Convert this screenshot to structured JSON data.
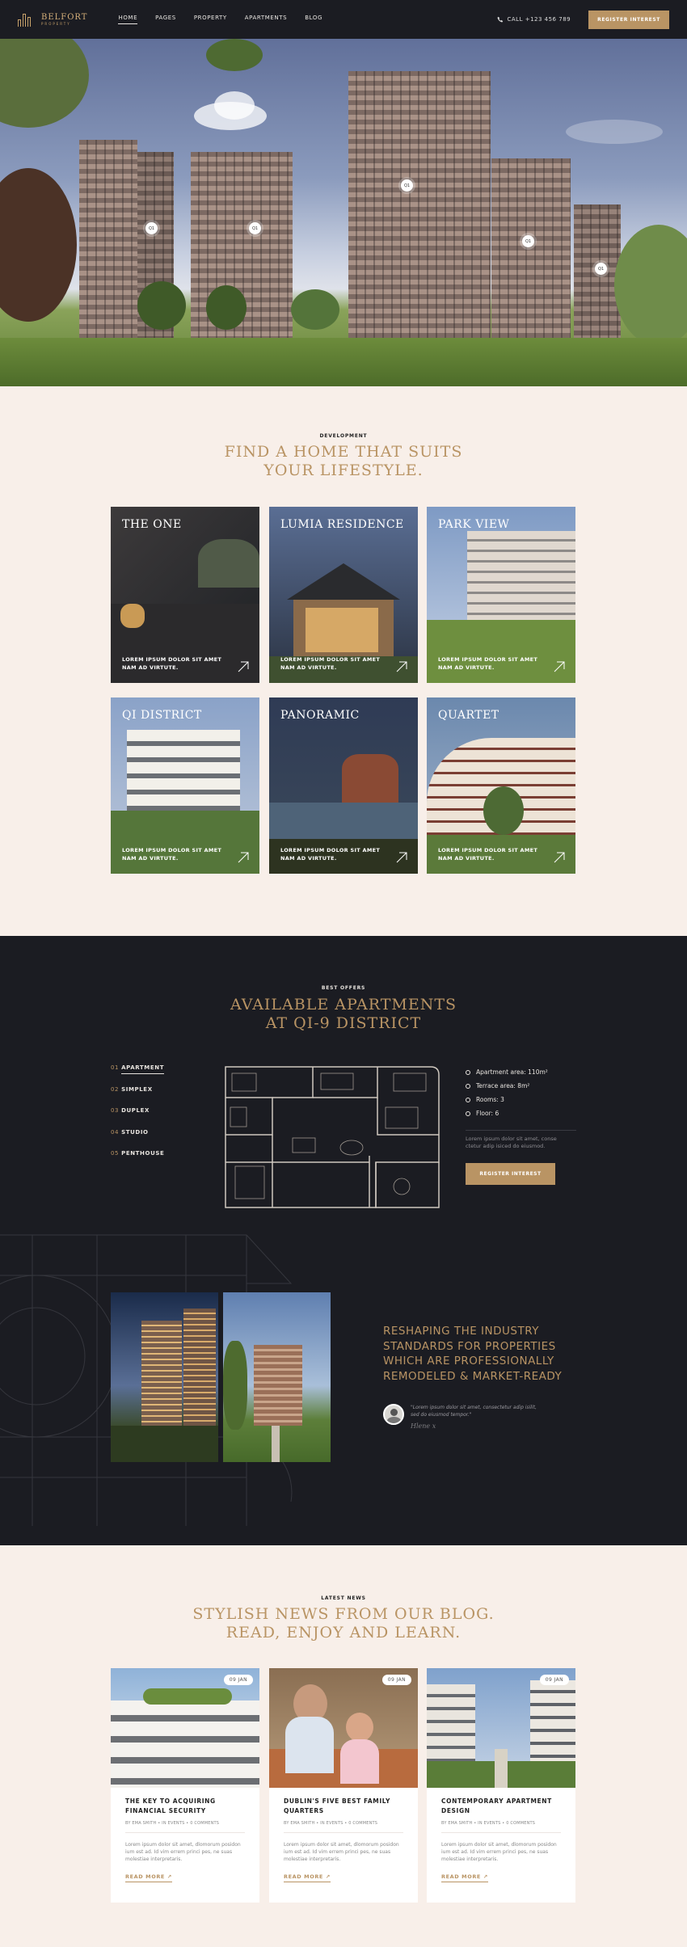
{
  "header": {
    "logo_name": "BELFORT",
    "logo_sub": "PROPERTY",
    "nav": [
      {
        "label": "HOME",
        "active": true
      },
      {
        "label": "PAGES"
      },
      {
        "label": "PROPERTY"
      },
      {
        "label": "APARTMENTS"
      },
      {
        "label": "BLOG"
      }
    ],
    "phone": "CALL +123 456 789",
    "cta": "REGISTER INTEREST"
  },
  "hero": {
    "hotspots": [
      "Q1",
      "Q1",
      "Q1",
      "Q1",
      "Q1"
    ]
  },
  "development": {
    "eyebrow": "DEVELOPMENT",
    "title_line1": "FIND A HOME THAT SUITS",
    "title_line2": "YOUR LIFESTYLE.",
    "cards": [
      {
        "title": "THE ONE",
        "text": "LOREM IPSUM DOLOR SIT AMET NAM AD VIRTUTE."
      },
      {
        "title": "LUMIA RESIDENCE",
        "text": "LOREM IPSUM DOLOR SIT AMET NAM AD VIRTUTE."
      },
      {
        "title": "PARK VIEW",
        "text": "LOREM IPSUM DOLOR SIT AMET NAM AD VIRTUTE."
      },
      {
        "title": "QI DISTRICT",
        "text": "LOREM IPSUM DOLOR SIT AMET NAM AD VIRTUTE."
      },
      {
        "title": "PANORAMIC",
        "text": "LOREM IPSUM DOLOR SIT AMET NAM AD VIRTUTE."
      },
      {
        "title": "QUARTET",
        "text": "LOREM IPSUM DOLOR SIT AMET NAM AD VIRTUTE."
      }
    ]
  },
  "apartments": {
    "eyebrow": "BEST OFFERS",
    "title_line1": "AVAILABLE APARTMENTS",
    "title_line2": "AT QI-9 DISTRICT",
    "list": [
      {
        "num": "01",
        "label": "APARTMENT",
        "active": true
      },
      {
        "num": "02",
        "label": "SIMPLEX"
      },
      {
        "num": "03",
        "label": "DUPLEX"
      },
      {
        "num": "04",
        "label": "STUDIO"
      },
      {
        "num": "05",
        "label": "PENTHOUSE"
      }
    ],
    "specs": [
      "Apartment area: 110m²",
      "Terrace area: 8m²",
      "Rooms: 3",
      "Floor: 6"
    ],
    "desc": "Lorem ipsum dolor sit amet, conse ctetur adip isiced do eiusmod.",
    "cta": "REGISTER INTEREST"
  },
  "about": {
    "headline_lines": [
      "RESHAPING THE INDUSTRY",
      "STANDARDS FOR PROPERTIES",
      "WHICH ARE PROFESSIONALLY",
      "REMODELED & MARKET-READY"
    ],
    "quote": "\"Lorem ipsum dolor sit amet, consectetur adip isilit, sed do eiusmod tempor.\"",
    "signature": "Hlene x"
  },
  "blog": {
    "eyebrow": "LATEST NEWS",
    "title_line1": "STYLISH NEWS FROM OUR BLOG.",
    "title_line2": "READ, ENJOY AND LEARN.",
    "posts": [
      {
        "date": "09 JAN",
        "title": "THE KEY TO ACQUIRING FINANCIAL SECURITY",
        "meta": "BY EMA SMITH • IN EVENTS • 0 COMMENTS",
        "excerpt": "Lorem ipsum dolor sit amet, dlomorum posidon ium est ad. Id vim errem princi pes, ne suas molestiae interpretaris.",
        "more": "READ MORE"
      },
      {
        "date": "09 JAN",
        "title": "DUBLIN'S FIVE BEST FAMILY QUARTERS",
        "meta": "BY EMA SMITH • IN EVENTS • 0 COMMENTS",
        "excerpt": "Lorem ipsum dolor sit amet, dlomorum posidon ium est ad. Id vim errem princi pes, ne suas molestiae interpretaris.",
        "more": "READ MORE"
      },
      {
        "date": "09 JAN",
        "title": "CONTEMPORARY APARTMENT DESIGN",
        "meta": "BY EMA SMITH • IN EVENTS • 0 COMMENTS",
        "excerpt": "Lorem ipsum dolor sit amet, dlomorum posidon ium est ad. Id vim errem princi pes, ne suas molestiae interpretaris.",
        "more": "READ MORE"
      }
    ]
  }
}
